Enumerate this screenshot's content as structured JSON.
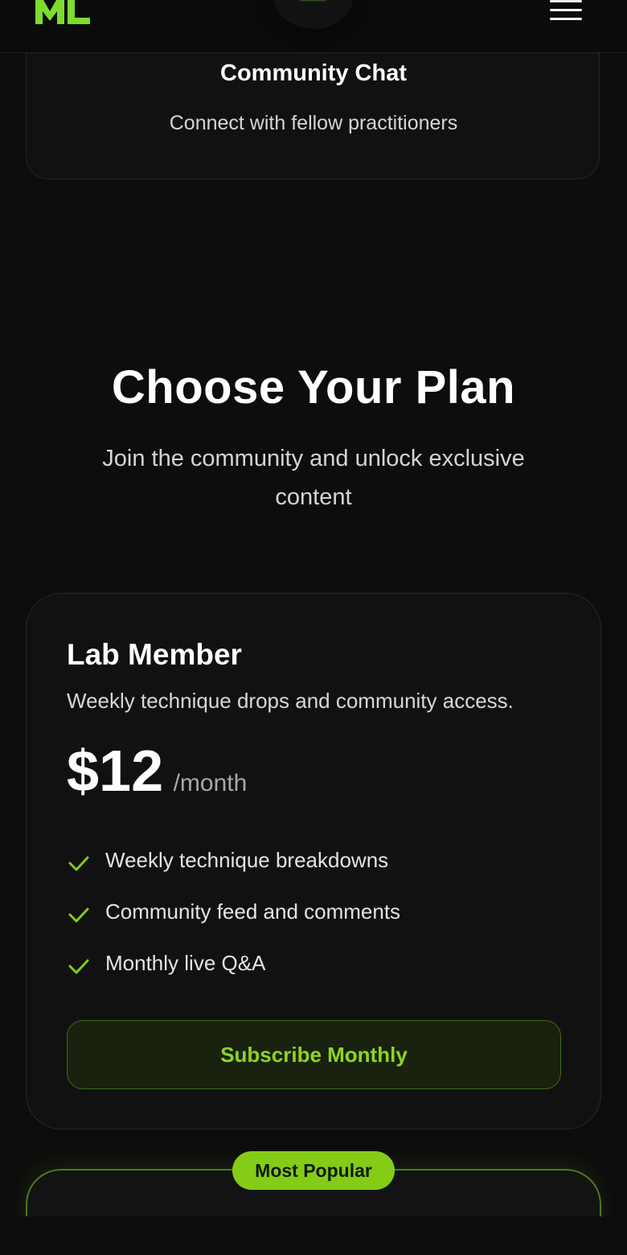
{
  "header": {
    "logo_text": "ML",
    "logo_color": "#7ddc2e",
    "center_icon": "chat-bubble-icon",
    "menu_icon": "hamburger-menu-icon"
  },
  "feature_card": {
    "icon": "chat-bubble-icon",
    "title": "Community Chat",
    "description": "Connect with fellow practitioners"
  },
  "plans_section": {
    "title": "Choose Your Plan",
    "subtitle": "Join the community and unlock exclusive content"
  },
  "plan": {
    "name": "Lab Member",
    "description": "Weekly technique drops and community access.",
    "price": "$12",
    "period": "/month",
    "features": [
      "Weekly technique breakdowns",
      "Community feed and comments",
      "Monthly live Q&A"
    ],
    "feature_icon": "check-icon",
    "cta_label": "Subscribe Monthly"
  },
  "next_plan": {
    "badge": "Most Popular"
  },
  "colors": {
    "background": "#0d0d0d",
    "card": "#111111",
    "accent": "#84cc16",
    "accent_text": "#8fd422",
    "button_bg": "#18220f"
  }
}
